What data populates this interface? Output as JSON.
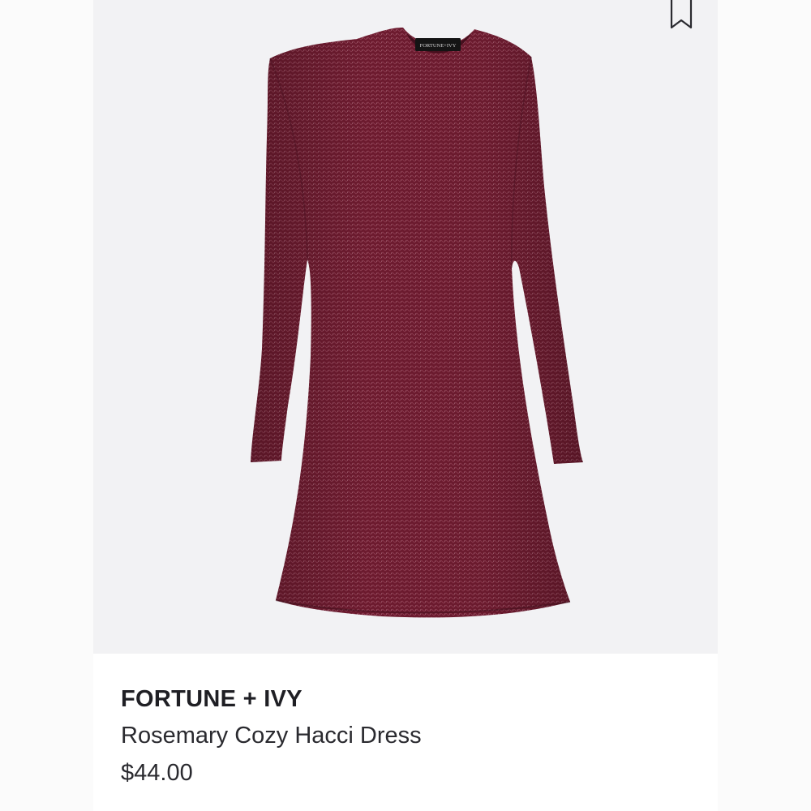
{
  "product": {
    "label_text": "FORTUNE+IVY",
    "brand": "FORTUNE + IVY",
    "name": "Rosemary Cozy Hacci Dress",
    "price": "$44.00"
  },
  "icons": {
    "bookmark": "bookmark-icon"
  },
  "colors": {
    "dress": "#6e1a2f",
    "dress_shadow": "#541426",
    "image_background": "#f2f2f4",
    "text": "#2a2a2f"
  }
}
